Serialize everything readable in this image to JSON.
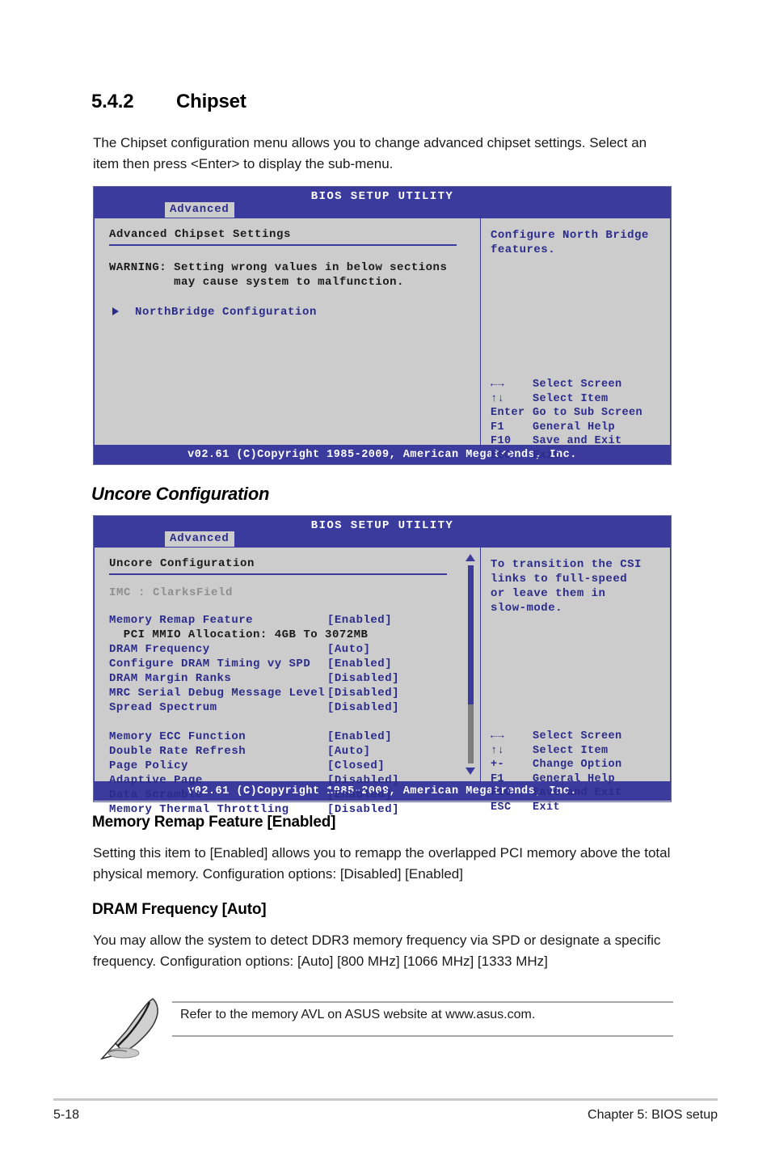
{
  "document": {
    "section_number": "5.4.2",
    "section_title": "Chipset",
    "intro": "The Chipset configuration menu allows you to change advanced chipset settings. Select an item then press <Enter> to display the sub-menu.",
    "subheading": "Uncore Configuration",
    "items": [
      {
        "title": "Memory Remap Feature [Enabled]",
        "body": "Setting this item to [Enabled] allows you to remapp the overlapped PCI memory above the total physical memory. Configuration options: [Disabled] [Enabled]"
      },
      {
        "title": "DRAM Frequency [Auto]",
        "body": "You may allow the system to detect DDR3 memory frequency via SPD or designate a specific frequency. Configuration options: [Auto] [800 MHz] [1066 MHz] [1333 MHz]"
      }
    ],
    "note": {
      "icon": "pencil-icon",
      "text": "Refer to the memory AVL on ASUS website at www.asus.com."
    },
    "footer": {
      "page_number": "5-18",
      "chapter": "Chapter 5: BIOS setup"
    }
  },
  "bios_screen_1": {
    "title": "BIOS SETUP UTILITY",
    "tab": "Advanced",
    "panel_title": "Advanced Chipset Settings",
    "warning": "WARNING: Setting wrong values in below sections\n         may cause system to malfunction.",
    "submenu_item": "NorthBridge Configuration",
    "help": "Configure North Bridge features.",
    "keys": [
      {
        "key": "←→",
        "desc": "Select Screen"
      },
      {
        "key": "↑↓",
        "desc": "Select Item"
      },
      {
        "key": "Enter",
        "desc": "Go to Sub Screen"
      },
      {
        "key": "F1",
        "desc": "General Help"
      },
      {
        "key": "F10",
        "desc": "Save and Exit"
      },
      {
        "key": "ESC",
        "desc": "Exit"
      }
    ],
    "footer": "v02.61  (C)Copyright 1985-2009, American Megatrends, Inc."
  },
  "bios_screen_2": {
    "title": "BIOS SETUP UTILITY",
    "tab": "Advanced",
    "panel_title": "Uncore Configuration",
    "imc_line": "IMC : ClarksField",
    "options": [
      {
        "name": "Memory Remap Feature",
        "value": "[Enabled]",
        "kind": "option"
      },
      {
        "name": "  PCI MMIO Allocation: 4GB To 3072MB",
        "value": "",
        "kind": "sub"
      },
      {
        "name": "DRAM Frequency",
        "value": "[Auto]",
        "kind": "option"
      },
      {
        "name": "Configure DRAM Timing vy SPD",
        "value": "[Enabled]",
        "kind": "option"
      },
      {
        "name": "DRAM Margin Ranks",
        "value": "[Disabled]",
        "kind": "option"
      },
      {
        "name": "MRC Serial Debug Message Level",
        "value": "[Disabled]",
        "kind": "option"
      },
      {
        "name": "Spread Spectrum",
        "value": "[Disabled]",
        "kind": "option"
      },
      {
        "name": "",
        "value": "",
        "kind": "spacer"
      },
      {
        "name": "Memory ECC Function",
        "value": "[Enabled]",
        "kind": "option"
      },
      {
        "name": "Double Rate Refresh",
        "value": "[Auto]",
        "kind": "option"
      },
      {
        "name": "Page Policy",
        "value": "[Closed]",
        "kind": "option"
      },
      {
        "name": "Adaptive Page",
        "value": "[Disabled]",
        "kind": "option"
      },
      {
        "name": "Data Scramble",
        "value": "[Enabled]",
        "kind": "option"
      },
      {
        "name": "Memory Thermal Throttling",
        "value": "[Disabled]",
        "kind": "option"
      }
    ],
    "help": "To transition the CSI\n links to full-speed\n or leave them in\n slow-mode.",
    "keys": [
      {
        "key": "←→",
        "desc": "Select Screen"
      },
      {
        "key": "↑↓",
        "desc": "Select Item"
      },
      {
        "key": "+-",
        "desc": "Change Option"
      },
      {
        "key": "F1",
        "desc": "General Help"
      },
      {
        "key": "F10",
        "desc": "Save and Exit"
      },
      {
        "key": "ESC",
        "desc": "Exit"
      }
    ],
    "footer": "v02.61  (C)Copyright 1985-2009, American Megatrends, Inc."
  },
  "colors": {
    "bios_blue": "#3b3b9e",
    "bios_text_blue": "#2b2b8c",
    "bios_bg": "#cccccc",
    "bios_gray_text": "#8f8f8f",
    "scroll_track": "#7d7d7d"
  }
}
